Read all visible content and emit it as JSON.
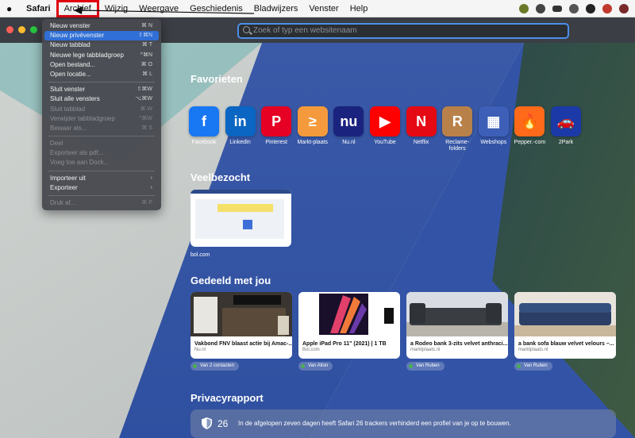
{
  "menubar": {
    "apple_icon": "apple-logo-icon",
    "app_name": "Safari",
    "items": [
      "Archief",
      "Wijzig",
      "Weergave",
      "Geschiedenis",
      "Bladwijzers",
      "Venster",
      "Help"
    ],
    "status_icons": [
      "status-icon-1",
      "status-icon-2",
      "cloud-icon",
      "status-icon-4",
      "help-icon",
      "status-icon-6",
      "status-icon-7"
    ]
  },
  "toolbar": {
    "search_placeholder": "Zoek of typ een websitenaam"
  },
  "favorites": {
    "title": "Favorieten",
    "items": [
      {
        "label": "Facebook",
        "glyph": "f",
        "color": "#1877f2"
      },
      {
        "label": "LinkedIn",
        "glyph": "in",
        "color": "#0a66c2"
      },
      {
        "label": "Pinterest",
        "glyph": "P",
        "color": "#e60023"
      },
      {
        "label": "Markt-plaats",
        "glyph": "≥",
        "color": "#f59a3c"
      },
      {
        "label": "Nu.nl",
        "glyph": "nu",
        "color": "#1a237e"
      },
      {
        "label": "YouTube",
        "glyph": "▶",
        "color": "#ff0000"
      },
      {
        "label": "Netflix",
        "glyph": "N",
        "color": "#e50914"
      },
      {
        "label": "Reclame-folders",
        "glyph": "R",
        "color": "#b9814a"
      },
      {
        "label": "Webshops",
        "glyph": "▦",
        "color": "#3d5fb8"
      },
      {
        "label": "Pepper.-com",
        "glyph": "🔥",
        "color": "#ff6a1a"
      },
      {
        "label": "2Park",
        "glyph": "🚗",
        "color": "#1b3aa8"
      }
    ]
  },
  "frequently_visited": {
    "title": "Veelbezocht",
    "items": [
      {
        "label": "bol.com"
      }
    ]
  },
  "shared": {
    "title": "Gedeeld met jou",
    "items": [
      {
        "title": "Vakbond FNV blaast actie bij Amac-...",
        "source": "Nu.nl",
        "from": "Van 2 contacten"
      },
      {
        "title": "Apple iPad Pro 11\" (2021) | 1 TB",
        "source": "Bol.com",
        "from": "Van Alton"
      },
      {
        "title": "a Rodeo bank 3-zits velvet anthraci...",
        "source": "marktplaats.nl",
        "from": "Van Ruben"
      },
      {
        "title": "a bank sofa blauw velvet velours –...",
        "source": "marktplaats.nl",
        "from": "Van Ruben"
      }
    ]
  },
  "privacy": {
    "title": "Privacyrapport",
    "count": "26",
    "text": "In de afgelopen zeven dagen heeft Safari 26 trackers verhinderd een profiel van je op te bouwen."
  },
  "file_menu": {
    "items": [
      {
        "label": "Nieuw venster",
        "shortcut": "⌘ N",
        "state": "normal"
      },
      {
        "label": "Nieuw privévenster",
        "shortcut": "⇧⌘N",
        "state": "selected"
      },
      {
        "label": "Nieuw tabblad",
        "shortcut": "⌘ T",
        "state": "normal"
      },
      {
        "label": "Nieuwe lege tabbladgroep",
        "shortcut": "^⌘N",
        "state": "normal"
      },
      {
        "label": "Open bestand...",
        "shortcut": "⌘ O",
        "state": "normal"
      },
      {
        "label": "Open locatie...",
        "shortcut": "⌘ L",
        "state": "normal"
      },
      {
        "sep": true
      },
      {
        "label": "Sluit venster",
        "shortcut": "⇧⌘W",
        "state": "normal"
      },
      {
        "label": "Sluit alle vensters",
        "shortcut": "⌥⌘W",
        "state": "normal"
      },
      {
        "label": "Sluit tabblad",
        "shortcut": "⌘ W",
        "state": "disabled"
      },
      {
        "label": "Verwijder tabbladgroep",
        "shortcut": "^⌘W",
        "state": "disabled"
      },
      {
        "label": "Bewaar als...",
        "shortcut": "⌘ S",
        "state": "disabled"
      },
      {
        "sep": true
      },
      {
        "label": "Deel",
        "shortcut": "",
        "state": "disabled"
      },
      {
        "label": "Exporteer als pdf...",
        "shortcut": "",
        "state": "disabled"
      },
      {
        "label": "Voeg toe aan Dock...",
        "shortcut": "",
        "state": "disabled"
      },
      {
        "sep": true
      },
      {
        "label": "Importeer uit",
        "shortcut": "›",
        "state": "normal"
      },
      {
        "label": "Exporteer",
        "shortcut": "›",
        "state": "normal"
      },
      {
        "sep": true
      },
      {
        "label": "Druk af...",
        "shortcut": "⌘ P",
        "state": "disabled"
      }
    ]
  },
  "colors": {
    "accent": "#2f6fd6",
    "highlight_box": "#e00010",
    "background_blue": "#3b56a8"
  }
}
